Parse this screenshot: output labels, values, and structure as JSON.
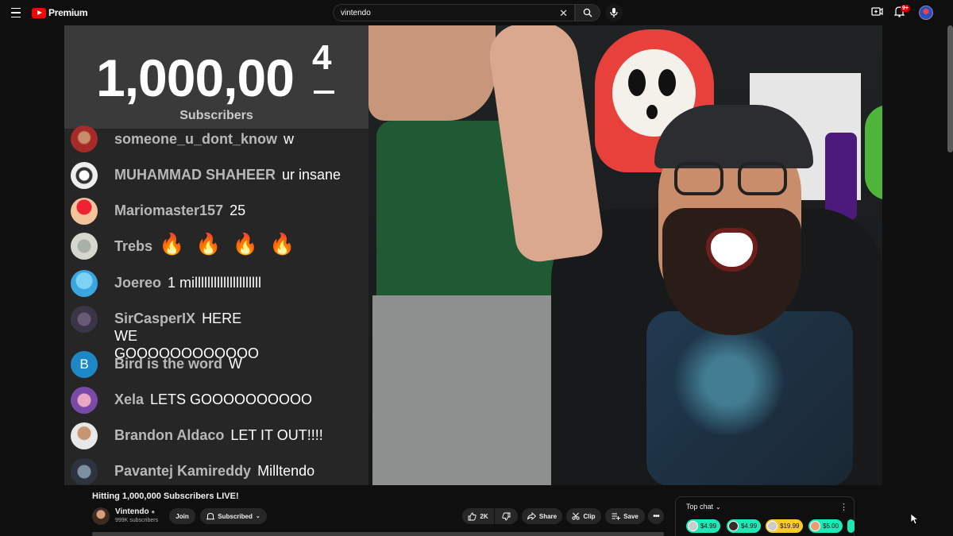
{
  "header": {
    "logo_text": "Premium",
    "search_value": "vintendo",
    "notification_badge": "9+"
  },
  "counter": {
    "main": "1,000,00",
    "last_digit": "4",
    "label": "Subscribers"
  },
  "chat_messages": [
    {
      "author": "someone_u_dont_know",
      "text": "w"
    },
    {
      "author": "MUHAMMAD SHAHEER",
      "text": "ur insane"
    },
    {
      "author": "Mariomaster157",
      "text": "25"
    },
    {
      "author": "Trebs",
      "text": "🔥🔥🔥🔥"
    },
    {
      "author": "Joereo",
      "text": "1 milllllllllllllllllllll"
    },
    {
      "author": "SirCasperIX",
      "text": "HERE WE GOOOOOOOOOOOO"
    },
    {
      "author": "Bird is the word",
      "text": "W",
      "avatar_letter": "B"
    },
    {
      "author": "Xela",
      "text": "LETS GOOOOOOOOOO"
    },
    {
      "author": "Brandon Aldaco",
      "text": "LET IT OUT!!!!"
    },
    {
      "author": "Pavantej Kamireddy",
      "text": "Milltendo"
    }
  ],
  "video_info": {
    "title": "Hitting 1,000,000 Subscribers LIVE!",
    "channel": "Vintendo",
    "subscribers": "999K subscribers",
    "join_label": "Join",
    "subscribed_label": "Subscribed",
    "like_count": "2K",
    "share_label": "Share",
    "clip_label": "Clip",
    "save_label": "Save"
  },
  "live_chat": {
    "mode_label": "Top chat",
    "super_chats": [
      {
        "amount": "$4.99",
        "color": "#1de9b6"
      },
      {
        "amount": "$4.99",
        "color": "#1de9b6"
      },
      {
        "amount": "$19.99",
        "color": "#ffca28"
      },
      {
        "amount": "$5.00",
        "color": "#1de9b6"
      }
    ]
  },
  "icons": [
    "menu-icon",
    "youtube-logo-icon",
    "clear-icon",
    "search-icon",
    "mic-icon",
    "create-icon",
    "bell-icon",
    "like-icon",
    "dislike-icon",
    "share-icon",
    "clip-icon",
    "save-icon",
    "more-icon",
    "chevron-down-icon",
    "kebab-icon",
    "bell-outline-icon",
    "verified-icon"
  ]
}
